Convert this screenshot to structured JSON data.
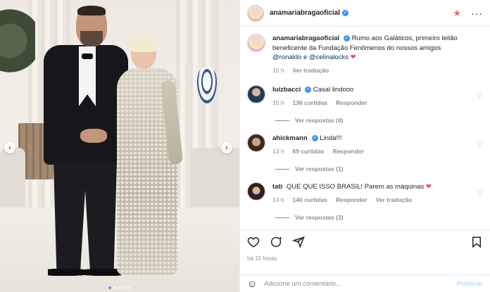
{
  "post": {
    "username": "anamariabragaoficial",
    "caption": {
      "text": "Rumo aos Galáticos, primeiro leilão beneficente da Fundação Fenômenos do nossos amigos",
      "mention1": "@ronaldo",
      "joiner": "e",
      "mention2": "@celinalocks",
      "heart": "❤"
    },
    "caption_time": "15 h",
    "see_translation": "Ver tradução",
    "posted_ago": "há 15 horas"
  },
  "comments": [
    {
      "username": "luizbacci",
      "text": "Casal lindooo",
      "time": "15 h",
      "likes": "136 curtidas",
      "reply": "Responder",
      "view_replies": "Ver respostas (4)"
    },
    {
      "username": "ahickmann",
      "text": "Linda!!!",
      "time": "13 h",
      "likes": "69 curtidas",
      "reply": "Responder",
      "view_replies": "Ver respostas (1)"
    },
    {
      "username": "tati",
      "text": "QUE QUE ISSO BRASIL! Parem as máquinas",
      "heart": "❤",
      "time": "14 h",
      "likes": "140 curtidas",
      "reply": "Responder",
      "translate": "Ver tradução",
      "view_replies": "Ver respostas (3)"
    }
  ],
  "composer": {
    "placeholder": "Adicione um comentário...",
    "publish": "Publicar"
  },
  "carousel": {
    "slide_count": 5,
    "active_slide": 0
  },
  "colors": {
    "verified": "#3897f0",
    "heart": "#ed4956",
    "mention": "#00376b",
    "publish": "#b2dffc"
  },
  "icons": [
    "like-icon",
    "comment-icon",
    "share-icon",
    "save-icon",
    "emoji-icon",
    "more-icon",
    "verified-icon"
  ]
}
